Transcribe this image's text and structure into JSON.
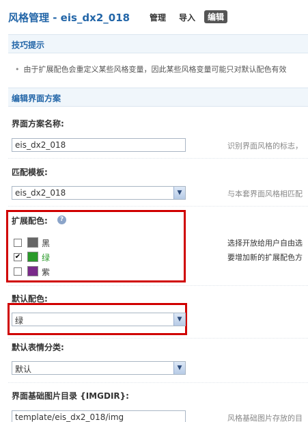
{
  "header": {
    "title": "风格管理 - eis_dx2_018",
    "nav": [
      "管理",
      "导入",
      "编辑"
    ]
  },
  "tips": {
    "heading": "技巧提示",
    "text": "由于扩展配色会重定义某些风格变量，因此某些风格变量可能只对默认配色有效"
  },
  "edit": {
    "heading": "编辑界面方案",
    "name_label": "界面方案名称:",
    "name_value": "eis_dx2_018",
    "name_hint": "识别界面风格的标志，",
    "template_label": "匹配模板:",
    "template_value": "eis_dx2_018",
    "template_hint": "与本套界面风格相匹配",
    "ext_label": "扩展配色:",
    "ext_colors": [
      {
        "label": "黑",
        "color": "#666666",
        "checked": false,
        "text_color": "#333333"
      },
      {
        "label": "绿",
        "color": "#2a9a2a",
        "checked": true,
        "text_color": "#2a9a2a"
      },
      {
        "label": "紫",
        "color": "#7a2a8a",
        "checked": false,
        "text_color": "#333333"
      }
    ],
    "ext_hint_1": "选择开放给用户自由选",
    "ext_hint_2": "要增加新的扩展配色方",
    "default_label": "默认配色:",
    "default_value": "绿",
    "emoticon_label": "默认表情分类:",
    "emoticon_value": "默认",
    "imgdir_label": "界面基础图片目录 {IMGDIR}:",
    "imgdir_value": "template/eis_dx2_018/img",
    "imgdir_hint": "风格基础图片存放的目"
  },
  "colors": {
    "accent": "#2366a8",
    "highlight": "#d00000"
  }
}
